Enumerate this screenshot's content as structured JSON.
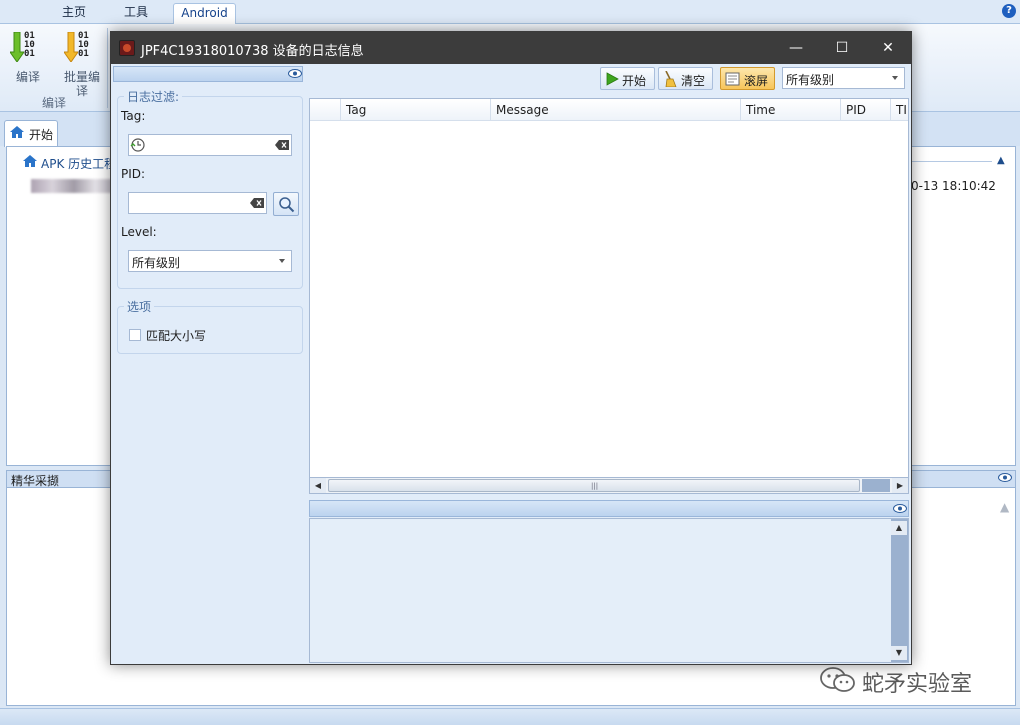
{
  "app": {
    "menu_tabs": [
      {
        "label": "主页"
      },
      {
        "label": "工具"
      },
      {
        "label": "Android"
      }
    ],
    "help": "?",
    "ribbon": {
      "compile_label": "编译",
      "batch_compile_label": "批量编译",
      "group_label": "编译",
      "bits": "01\n10\n01"
    },
    "start_tab_label": "开始",
    "apk_history_label": "APK 历史工程",
    "history_time": "0-13 18:10:42",
    "collapse_glyph": "▲",
    "jinghua_label": "精华采撷",
    "watermark": "蛇矛实验室"
  },
  "log_window": {
    "title": "JPF4C19318010738 设备的日志信息",
    "controls": {
      "minimize": "—",
      "maximize": "☐",
      "close": "✕"
    },
    "filter": {
      "group_title": "日志过滤:",
      "tag_label": "Tag:",
      "tag_value": "",
      "pid_label": "PID:",
      "pid_value": "",
      "level_label": "Level:",
      "level_value": "所有级别"
    },
    "options": {
      "group_title": "选项",
      "match_case_label": "匹配大小写",
      "match_case_checked": false
    },
    "toolbar": {
      "start_label": "开始",
      "clear_label": "清空",
      "scroll_label": "滚屏",
      "level_value": "所有级别"
    },
    "table": {
      "columns": [
        "Tag",
        "Message",
        "Time",
        "PID",
        "TII"
      ],
      "rows": []
    },
    "scroll": {
      "left": "◀",
      "right": "▶",
      "up": "▲",
      "down": "▼",
      "grip": "|||"
    }
  },
  "colors": {
    "accent": "#15428b",
    "titlebar": "#3c3c3c",
    "active_button": "#f7c55a"
  }
}
